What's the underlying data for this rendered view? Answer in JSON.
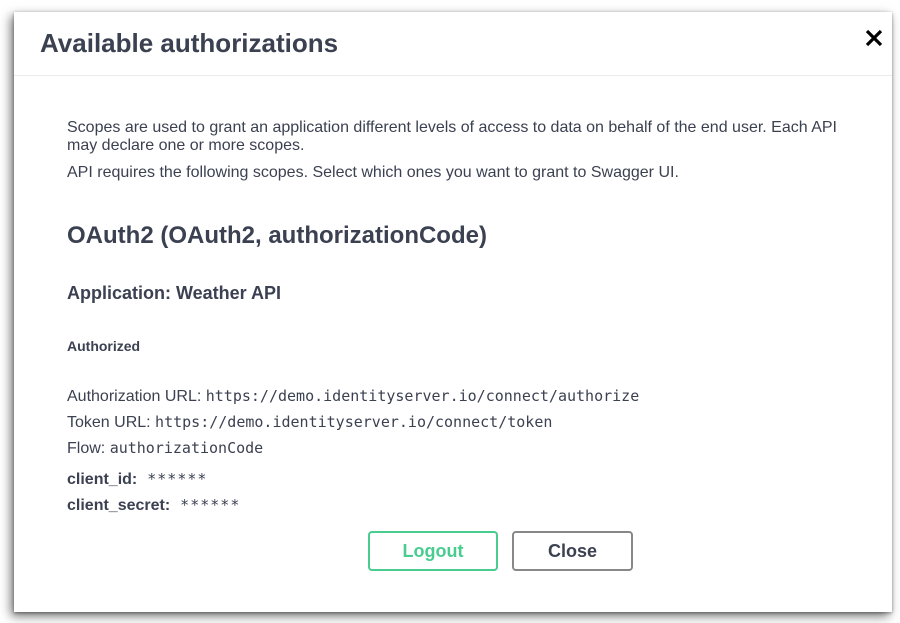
{
  "dialog": {
    "title": "Available authorizations",
    "close_icon": "close-x-icon"
  },
  "description": {
    "line1": "Scopes are used to grant an application different levels of access to data on behalf of the end user. Each API may declare one or more scopes.",
    "line2": "API requires the following scopes. Select which ones you want to grant to Swagger UI."
  },
  "scheme": {
    "title": "OAuth2 (OAuth2, authorizationCode)",
    "application": "Application: Weather API",
    "status": "Authorized",
    "authorization_url_label": "Authorization URL:",
    "authorization_url": "https://demo.identityserver.io/connect/authorize",
    "token_url_label": "Token URL:",
    "token_url": "https://demo.identityserver.io/connect/token",
    "flow_label": "Flow:",
    "flow": "authorizationCode",
    "client_id_label": "client_id:",
    "client_id_value": "******",
    "client_secret_label": "client_secret:",
    "client_secret_value": "******"
  },
  "buttons": {
    "logout": "Logout",
    "close": "Close"
  },
  "colors": {
    "text": "#3b4151",
    "logout_accent": "#49cc90",
    "close_border": "#888888"
  }
}
